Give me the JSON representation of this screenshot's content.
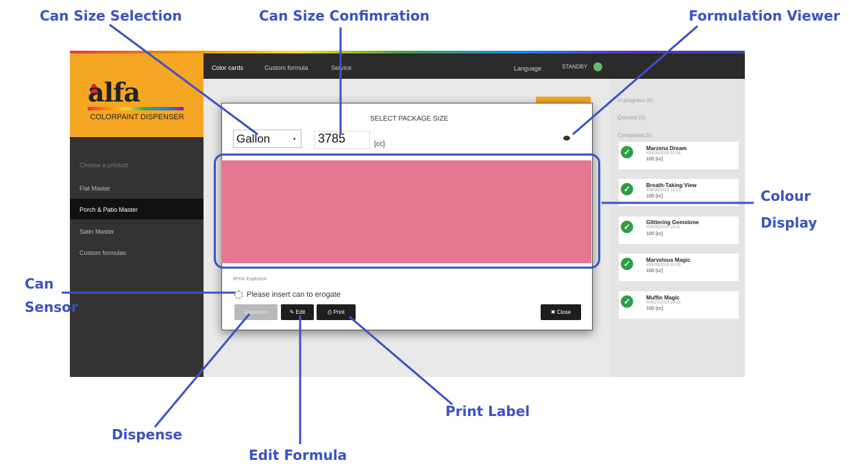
{
  "annotations": {
    "can_size_selection": "Can Size Selection",
    "can_size_confirmation": "Can Size Confimration",
    "formulation_viewer": "Formulation Viewer",
    "colour_display_line1": "Colour",
    "colour_display_line2": "Display",
    "can_sensor_line1": "Can",
    "can_sensor_line2": "Sensor",
    "dispense": "Dispense",
    "edit_formula": "Edit Formula",
    "print_label": "Print Label",
    "annotation_color": "#3b52c4"
  },
  "logo": {
    "brand": "alfa",
    "subtitle": "COLORPAINT DISPENSER",
    "panel_color": "#f5a623"
  },
  "nav_tabs": [
    "Color cards",
    "Custom formula",
    "Service"
  ],
  "topbar": {
    "language": "Language",
    "status": "STANDBY",
    "status_color": "#66bb6a"
  },
  "sidebar": {
    "header": "Choose a product",
    "items": [
      "Flat Master",
      "Porch & Patio Master",
      "Satin Master",
      "Custom formulas"
    ],
    "active_index": 1
  },
  "modal": {
    "title": "SELECT PACKAGE SIZE",
    "can_size_selected": "Gallon",
    "volume_value": "3785",
    "volume_unit": "[cc]",
    "color_name": "#Pink Explosion",
    "color_hex": "#e57890",
    "sensor_message": "Please insert can to erogate",
    "buttons": {
      "dispense": "Dispense",
      "edit": "Edit",
      "print": "Print",
      "close": "Close"
    }
  },
  "queue": {
    "in_progress": "In progress (0)",
    "queued": "Queued (0)",
    "completed": "Completed (5)",
    "items": [
      {
        "name": "Marzena Dream",
        "date": "#09/28/2019 15:14",
        "qty": "100 [cc]"
      },
      {
        "name": "Breath-Taking View",
        "date": "#09/28/2019 15:13",
        "qty": "100 [cc]"
      },
      {
        "name": "Glittering Gemstone",
        "date": "#09/28/2019 15:11",
        "qty": "100 [cc]"
      },
      {
        "name": "Marvelous Magic",
        "date": "#09/28/2019 15:09",
        "qty": "100 [cc]"
      },
      {
        "name": "Muffin Magic",
        "date": "#09/27/2019 14:13",
        "qty": "100 [cc]"
      }
    ]
  }
}
